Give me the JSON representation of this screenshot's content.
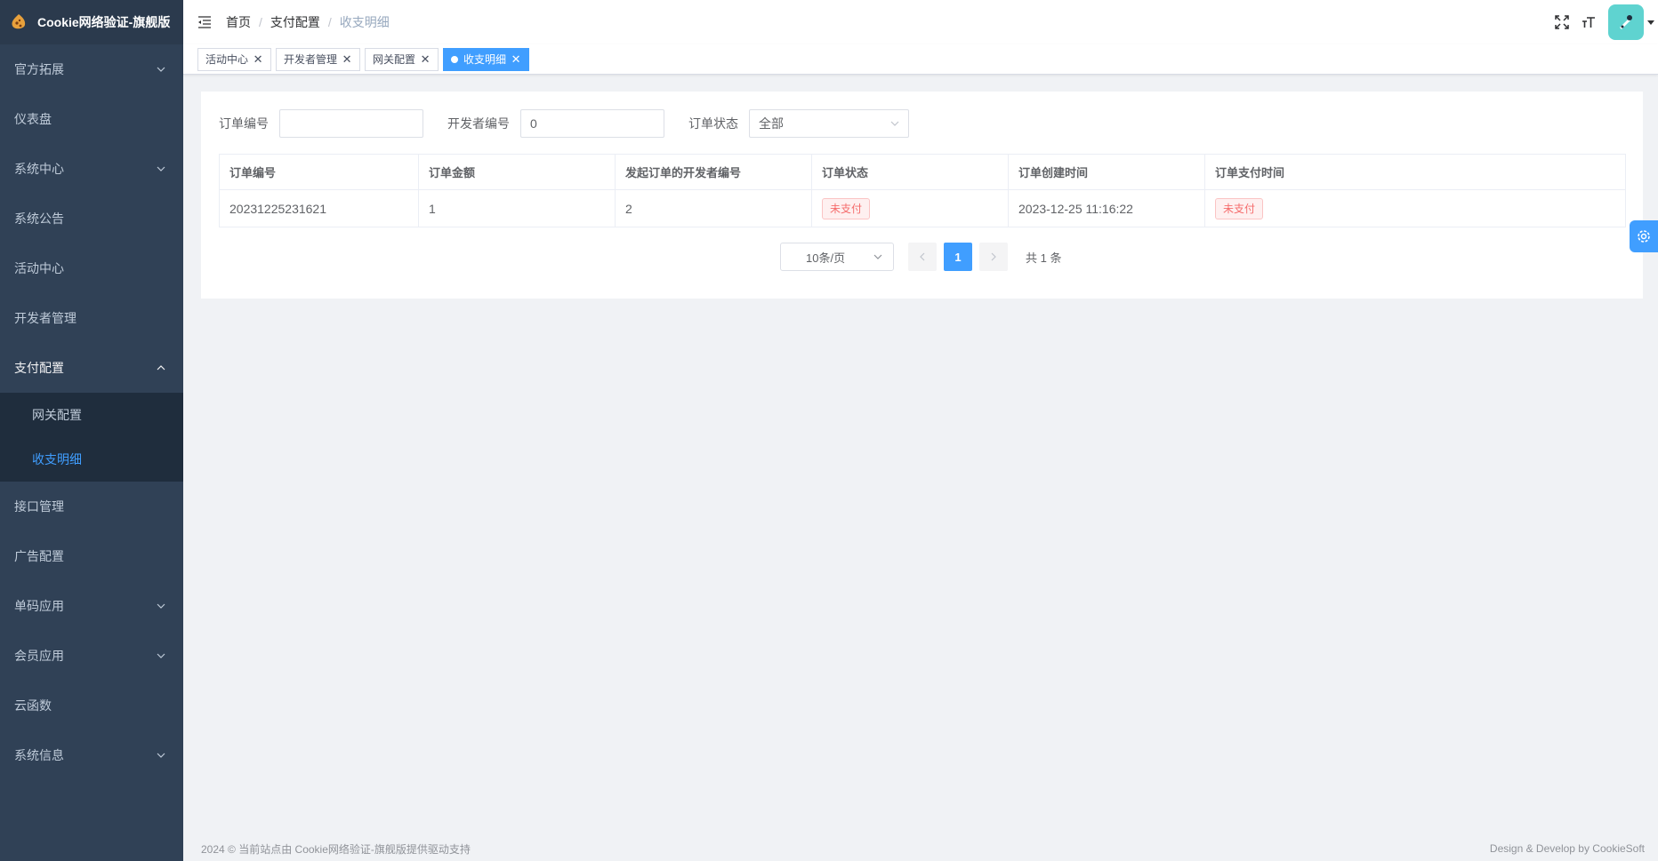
{
  "app": {
    "title": "Cookie网络验证-旗舰版"
  },
  "sidebar": {
    "items": [
      {
        "label": "官方拓展",
        "has_arrow": true
      },
      {
        "label": "仪表盘"
      },
      {
        "label": "系统中心",
        "has_arrow": true
      },
      {
        "label": "系统公告"
      },
      {
        "label": "活动中心"
      },
      {
        "label": "开发者管理"
      },
      {
        "label": "支付配置",
        "expanded": true
      },
      {
        "label": "网关配置"
      },
      {
        "label": "收支明细"
      },
      {
        "label": "接口管理"
      },
      {
        "label": "广告配置"
      },
      {
        "label": "单码应用",
        "has_arrow": true
      },
      {
        "label": "会员应用",
        "has_arrow": true
      },
      {
        "label": "云函数"
      },
      {
        "label": "系统信息",
        "has_arrow": true
      }
    ]
  },
  "breadcrumb": [
    "首页",
    "支付配置",
    "收支明细"
  ],
  "tags": [
    "活动中心",
    "开发者管理",
    "网关配置",
    "收支明细"
  ],
  "filters": {
    "order_no_label": "订单编号",
    "order_no_value": "",
    "dev_no_label": "开发者编号",
    "dev_no_value": "0",
    "status_label": "订单状态",
    "status_value": "全部"
  },
  "table": {
    "headers": [
      "订单编号",
      "订单金额",
      "发起订单的开发者编号",
      "订单状态",
      "订单创建时间",
      "订单支付时间"
    ],
    "rows": [
      [
        "20231225231621",
        "1",
        "2",
        "未支付",
        "2023-12-25 11:16:22",
        "未支付"
      ]
    ]
  },
  "pagination": {
    "page_size": "10条/页",
    "current": "1",
    "total": "共 1 条"
  },
  "footer": {
    "left": "2024 © 当前站点由 Cookie网络验证-旗舰版提供驱动支持",
    "right": "Design & Develop by CookieSoft"
  },
  "colors": {
    "sidebar_bg": "#304156",
    "accent": "#409eff",
    "danger": "#f56c6c"
  }
}
